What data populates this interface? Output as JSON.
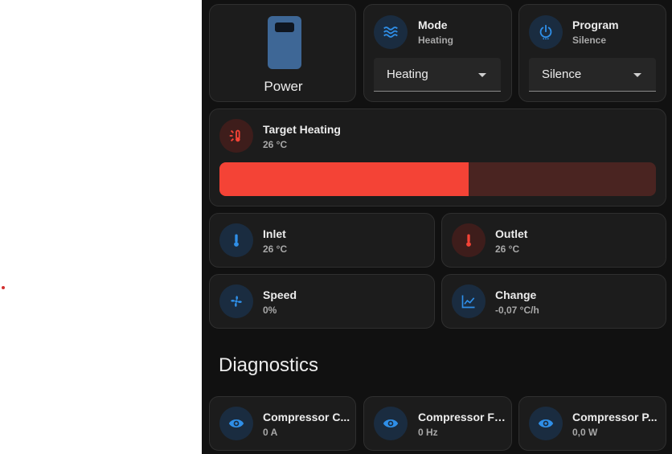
{
  "power": {
    "label": "Power"
  },
  "mode": {
    "title": "Mode",
    "state": "Heating",
    "select_value": "Heating",
    "icon": "waves-icon"
  },
  "program": {
    "title": "Program",
    "state": "Silence",
    "select_value": "Silence",
    "icon": "power-icon"
  },
  "target": {
    "title": "Target Heating",
    "state": "26 °C",
    "slider_fraction": 0.57,
    "icon": "heating-thermometer-icon"
  },
  "inlet": {
    "title": "Inlet",
    "state": "26 °C",
    "icon": "thermometer-icon"
  },
  "outlet": {
    "title": "Outlet",
    "state": "26 °C",
    "icon": "thermometer-icon"
  },
  "speed": {
    "title": "Speed",
    "state": "0%",
    "icon": "fan-icon"
  },
  "change": {
    "title": "Change",
    "state": "-0,07 °C/h",
    "icon": "chart-line-icon"
  },
  "diagnostics": {
    "heading": "Diagnostics",
    "items": [
      {
        "title": "Compressor C...",
        "state": "0 A",
        "icon": "eye-icon"
      },
      {
        "title": "Compressor Fr...",
        "state": "0 Hz",
        "icon": "eye-icon"
      },
      {
        "title": "Compressor P...",
        "state": "0,0 W",
        "icon": "eye-icon"
      }
    ]
  },
  "colors": {
    "background": "#111111",
    "card": "#1c1c1c",
    "accent_blue": "#2f8fe8",
    "accent_red": "#f44336",
    "slider_track": "#4a2421"
  }
}
